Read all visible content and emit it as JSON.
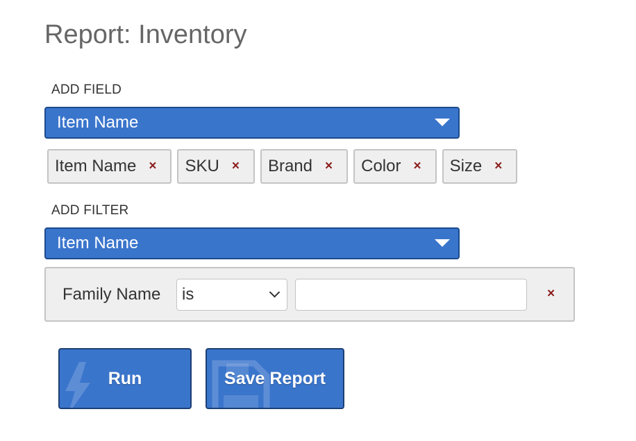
{
  "page": {
    "title": "Report: Inventory"
  },
  "add_field": {
    "label": "ADD FIELD",
    "selected": "Item Name"
  },
  "fields": [
    {
      "label": "Item Name",
      "remove": "×"
    },
    {
      "label": "SKU",
      "remove": "×"
    },
    {
      "label": "Brand",
      "remove": "×"
    },
    {
      "label": "Color",
      "remove": "×"
    },
    {
      "label": "Size",
      "remove": "×"
    }
  ],
  "add_filter": {
    "label": "ADD FILTER",
    "selected": "Item Name"
  },
  "filter": {
    "field": "Family Name",
    "operator": "is",
    "value": "",
    "remove": "×"
  },
  "actions": {
    "run_label": "Run",
    "save_label": "Save Report"
  },
  "colors": {
    "accent": "#3a75cc",
    "accent_border": "#1d4a8c",
    "remove_x": "#8b1d1d",
    "chip_bg": "#efefef"
  },
  "icons": {
    "add_field_caret": "caret-down-icon",
    "add_filter_caret": "caret-down-icon",
    "operator_chevron": "chevron-down-icon",
    "run_watermark": "lightning-bolt-icon",
    "save_watermark": "floppy-disk-icon"
  }
}
